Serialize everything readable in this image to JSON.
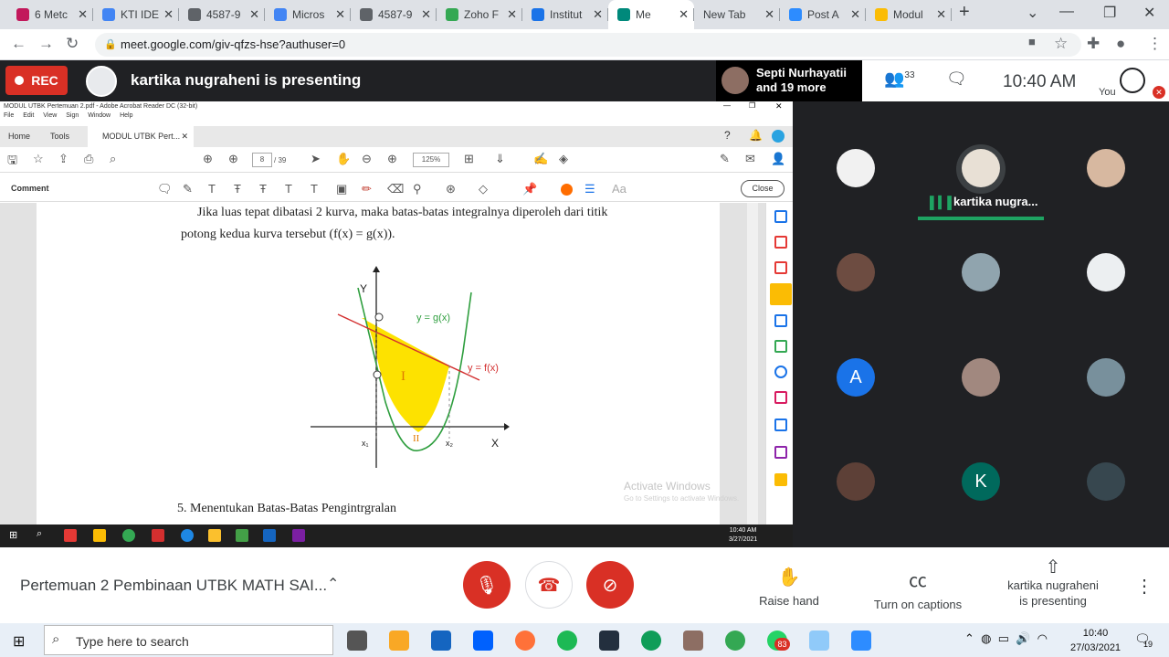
{
  "browser": {
    "tabs": [
      {
        "label": "6 Metc",
        "color": "#c2185b"
      },
      {
        "label": "KTI IDE",
        "color": "#4285f4"
      },
      {
        "label": "4587-9",
        "color": "#5f6368"
      },
      {
        "label": "Micros",
        "color": "#4285f4"
      },
      {
        "label": "4587-9",
        "color": "#5f6368"
      },
      {
        "label": "Zoho F",
        "color": "#34a853"
      },
      {
        "label": "Institut",
        "color": "#1a73e8"
      },
      {
        "label": "Me",
        "color": "#00897b"
      },
      {
        "label": "New Tab",
        "color": "#ffffff"
      },
      {
        "label": "Post A",
        "color": "#2d8cff"
      },
      {
        "label": "Modul",
        "color": "#fbbc04"
      }
    ],
    "url": "meet.google.com/giv-qfzs-hse?authuser=0"
  },
  "meet_top": {
    "rec_label": "REC",
    "presenting_text": "kartika nugraheni is presenting",
    "people_line1": "Septi Nurhayatii",
    "people_line2": "and 19 more",
    "participant_count": "33",
    "time": "10:40 AM",
    "you_label": "You"
  },
  "acrobat": {
    "window_title": "MODUL UTBK Pertemuan 2.pdf - Adobe Acrobat Reader DC (32-bit)",
    "menu": [
      "File",
      "Edit",
      "View",
      "Sign",
      "Window",
      "Help"
    ],
    "tabs": {
      "home": "Home",
      "tools": "Tools",
      "doc": "MODUL UTBK Pert..."
    },
    "page_current": "8",
    "page_total": "/ 39",
    "zoom": "125%",
    "comment_label": "Comment",
    "close_label": "Close",
    "doc": {
      "para1": "Jika luas tepat dibatasi 2 kurva, maka batas-batas integralnya diperoleh dari titik",
      "para2": "potong kedua kurva tersebut (f(x) = g(x)).",
      "para3": "5.   Menentukan Batas-Batas Pengintrgralan"
    },
    "figure": {
      "y_axis": "Y",
      "x_axis": "X",
      "g_label": "y = g(x)",
      "f_label": "y = f(x)",
      "x1": "x₁",
      "x2": "x₂",
      "region_i": "I",
      "region_ii": "II"
    },
    "watermark_line1": "Activate Windows",
    "watermark_line2": "Go to Settings to activate Windows.",
    "inner_time": "10:40 AM",
    "inner_date": "3/27/2021"
  },
  "participants": {
    "speaker_name": "kartika nugra...",
    "letter_a": "A",
    "letter_k": "K"
  },
  "meet_bottom": {
    "meeting_title": "Pertemuan 2 Pembinaan UTBK MATH SAI...",
    "raise_hand": "Raise hand",
    "captions": "Turn on captions",
    "presenting_line1": "kartika nugraheni",
    "presenting_line2": "is presenting"
  },
  "taskbar": {
    "search_placeholder": "Type here to search",
    "time": "10:40",
    "date": "27/03/2021",
    "badge": "83",
    "notif": "19"
  }
}
